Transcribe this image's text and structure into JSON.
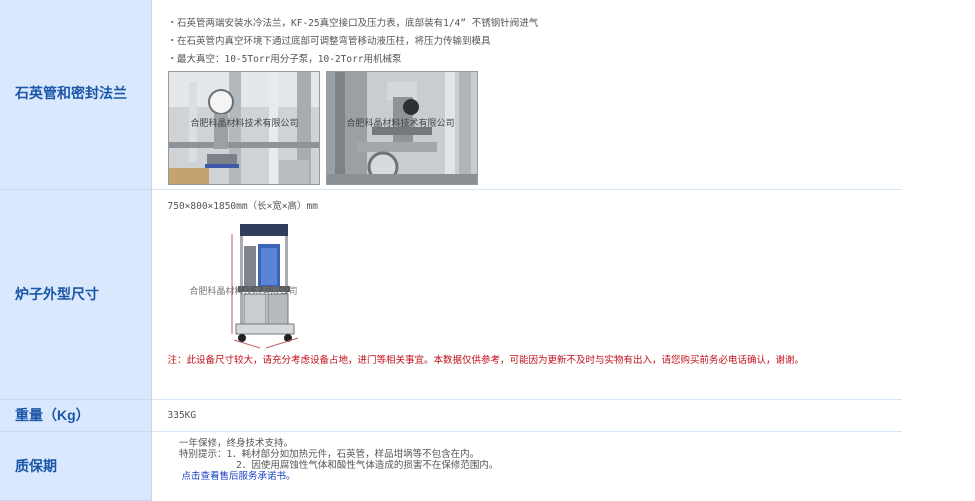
{
  "rows": {
    "flange": {
      "label": "石英管和密封法兰",
      "bullets": [
        "・石英管两端安装水冷法兰，KF-25真空接口及压力表，底部装有1/4” 不锈钢针阀进气",
        "・在石英管内真空环境下通过底部可调整弯管移动液压柱，将压力传输到模具",
        "・最大真空：10-5Torr用分子泵，10-2Torr用机械泵"
      ],
      "photo1_watermark": "合肥科晶材料技术有限公司",
      "photo2_watermark": "合肥科晶材料技术有限公司"
    },
    "size": {
      "label": "炉子外型尺寸",
      "dimensions": "750×800×1850mm（长×宽×高）mm",
      "watermark": "合肥科晶材料技术有限公司",
      "note": "注：此设备尺寸较大，请充分考虑设备占地，进门等相关事宜。本数据仅供参考，可能因为更新不及时与实物有出入，请您购买前务必电话确认，谢谢。"
    },
    "weight": {
      "label": "重量（Kg）",
      "value": "335KG"
    },
    "warranty": {
      "label": "质保期",
      "line1": "  一年保修，终身技术支持。",
      "line2": "  特别提示：1．耗材部分如加热元件，石英管，样品坩埚等不包含在内。",
      "line3": "            2．因使用腐蚀性气体和酸性气体造成的损害不在保修范围内。",
      "link": "点击查看售后服务承诺书。"
    }
  },
  "colors": {
    "label_bg": "#d9e8fd",
    "label_text": "#1a56a8",
    "note_red": "#c0101a",
    "link_blue": "#1a3fc4"
  }
}
